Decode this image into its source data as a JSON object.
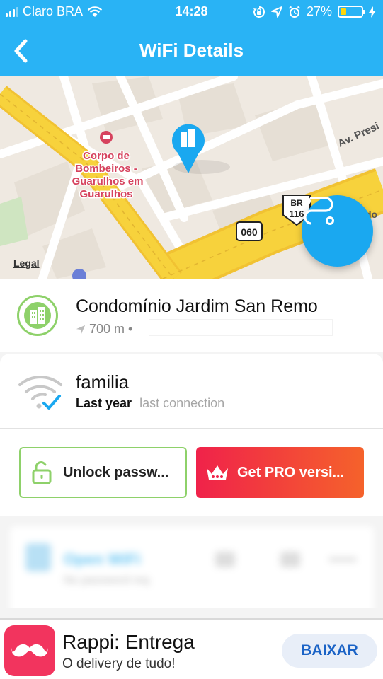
{
  "status_bar": {
    "carrier": "Claro BRA",
    "time": "14:28",
    "battery_percent": "27%",
    "battery_level": 0.27,
    "icons": [
      "signal-icon",
      "wifi-icon",
      "rotation-lock-icon",
      "location-arrow-icon",
      "alarm-icon",
      "battery-icon",
      "charging-icon"
    ]
  },
  "nav": {
    "title": "WiFi Details",
    "back_icon": "chevron-left-icon"
  },
  "map": {
    "labels": {
      "poi": "Corpo de Bombeiros - Guarulhos em Guarulhos",
      "poi_lines": [
        "Corpo de",
        "Bombeiros -",
        "Guarulhos em",
        "Guarulhos"
      ],
      "street": "Av. Presi",
      "shield_br": "BR",
      "shield_br_num": "116",
      "shield_060": "060",
      "road_edge": "do",
      "legal": "Legal"
    },
    "colors": {
      "highway": "#f7d23c",
      "road": "#ffffff",
      "block": "#ece7df",
      "poi_text": "#d6435e",
      "pin": "#1aa8f0"
    },
    "route_button_icon": "route-icon"
  },
  "location": {
    "name": "Condomínio Jardim San Remo",
    "distance": "700 m",
    "separator": "•",
    "icon": "building-icon"
  },
  "network": {
    "ssid": "familia",
    "last_seen": "Last year",
    "last_seen_caption": "last connection",
    "icon": "wifi-check-icon"
  },
  "actions": {
    "unlock_label": "Unlock passw...",
    "unlock_icon": "unlock-icon",
    "pro_label": "Get PRO versi...",
    "pro_icon": "crown-icon",
    "accent_green": "#8ed16a",
    "pro_gradient": [
      "#f0224a",
      "#f5622b"
    ]
  },
  "blurred_row": {
    "title": "Open WiFi",
    "subtitle": "No password req"
  },
  "ad": {
    "title": "Rappi: Entrega",
    "subtitle": "O delivery de tudo!",
    "cta": "BAIXAR",
    "icon": "mustache-icon",
    "brand_color": "#f2345e"
  },
  "colors": {
    "header": "#29b3f5"
  }
}
